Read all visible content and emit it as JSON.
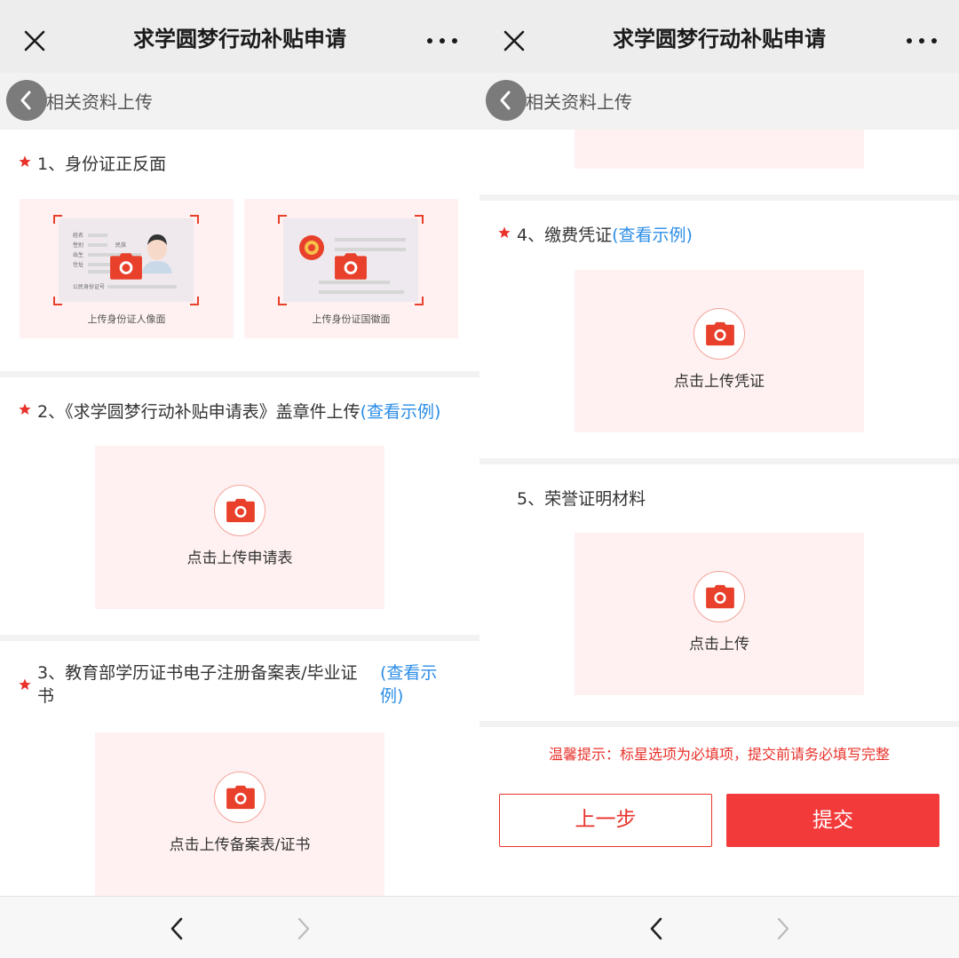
{
  "header": {
    "title": "求学圆梦行动补贴申请",
    "section_label": "相关资料上传"
  },
  "left": {
    "sections": [
      {
        "title": "1、身份证正反面",
        "link": ""
      },
      {
        "title": "2、《求学圆梦行动补贴申请表》盖章件上传",
        "link": "(查看示例)"
      },
      {
        "title": "3、教育部学历证书电子注册备案表/毕业证书",
        "link": "(查看示例)"
      }
    ],
    "id_front_caption": "上传身份证人像面",
    "id_back_caption": "上传身份证国徽面",
    "id_front_fields": [
      "姓名",
      "性别",
      "出生",
      "住址",
      "公民身份证号"
    ],
    "id_front_extra": "民族",
    "upload_form_text": "点击上传申请表",
    "upload_cert_text": "点击上传备案表/证书"
  },
  "right": {
    "sections": [
      {
        "title": "4、缴费凭证",
        "link": "(查看示例)"
      },
      {
        "title": "5、荣誉证明材料",
        "link": ""
      }
    ],
    "upload_voucher_text": "点击上传凭证",
    "upload_honor_text": "点击上传",
    "warning": "温馨提示：标星选项为必填项，提交前请务必填写完整",
    "prev_label": "上一步",
    "submit_label": "提交"
  },
  "colors": {
    "accent": "#e8322b",
    "link": "#2b8de6",
    "upload_bg": "#fff1f1"
  },
  "icons": [
    "close-icon",
    "more-icon",
    "back-icon",
    "star-icon",
    "camera-icon",
    "nav-back-icon",
    "nav-forward-icon"
  ]
}
